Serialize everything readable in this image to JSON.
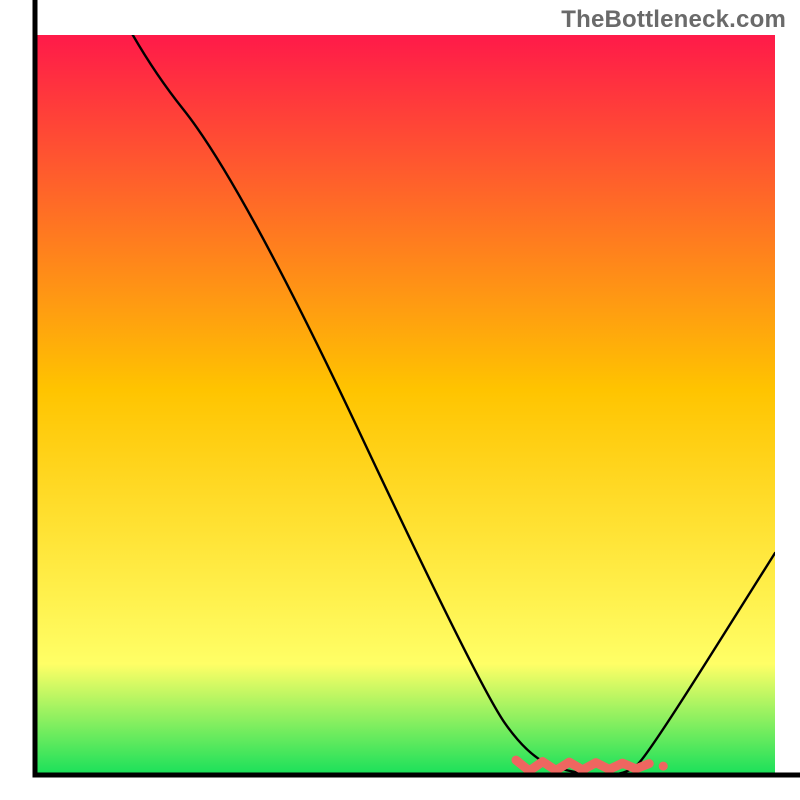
{
  "attribution": "TheBottleneck.com",
  "colors": {
    "grad_top": "#ff1a49",
    "grad_mid": "#ffc400",
    "grad_low": "#ffff66",
    "grad_bottom": "#18e05a",
    "curve": "#000000",
    "marker": "#ef6660",
    "axis": "#000000"
  },
  "chart_data": {
    "type": "line",
    "title": "",
    "xlabel": "",
    "ylabel": "",
    "xlim": [
      0,
      100
    ],
    "ylim": [
      0,
      100
    ],
    "x": [
      0,
      12,
      28,
      60,
      67,
      74,
      80,
      83,
      100
    ],
    "values": [
      130,
      100,
      80,
      12,
      2,
      0,
      0,
      3,
      30
    ],
    "optimal_region_x": [
      65,
      83
    ],
    "annotations": []
  }
}
